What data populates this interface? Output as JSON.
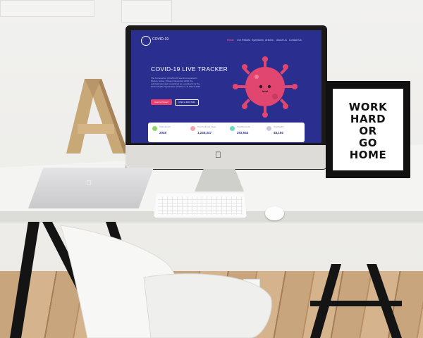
{
  "website": {
    "brand": "COVID-19",
    "nav": [
      "Home",
      "Our Results",
      "Symptoms",
      "Articles",
      "About Us",
      "Contact Us"
    ],
    "hero_title": "COVID-19 LIVE TRACKER",
    "hero_text": "The Coronavirus (COVID-19) was first reported in Wuhan, Hubei, China in December 2019, the outbreak was later recognized as a pandemic by the World Health Organization (WHO) on 11 March 2020.",
    "primary_button": "How to Protect",
    "secondary_button": "FIND A DOCTOR",
    "stats": [
      {
        "label": "Total Infected",
        "value": "2045",
        "color": "#8fd46b"
      },
      {
        "label": "Total Confirmed Cases",
        "value": "1,245,347",
        "color": "#f4a6b0"
      },
      {
        "label": "Total Recovered",
        "value": "253,544",
        "color": "#6fd9c2"
      },
      {
        "label": "Total Deaths",
        "value": "48,154",
        "color": "#c9c9d9"
      }
    ],
    "colors": {
      "background": "#2a2f8f",
      "accent": "#e8416b",
      "virus": "#e0466f"
    }
  },
  "poster": {
    "lines": [
      "WORK",
      "HARD",
      "OR",
      "GO",
      "HOME"
    ]
  },
  "decor": {
    "letter": "A",
    "monitor_logo": "apple-logo",
    "laptop_logo": "apple-logo"
  }
}
